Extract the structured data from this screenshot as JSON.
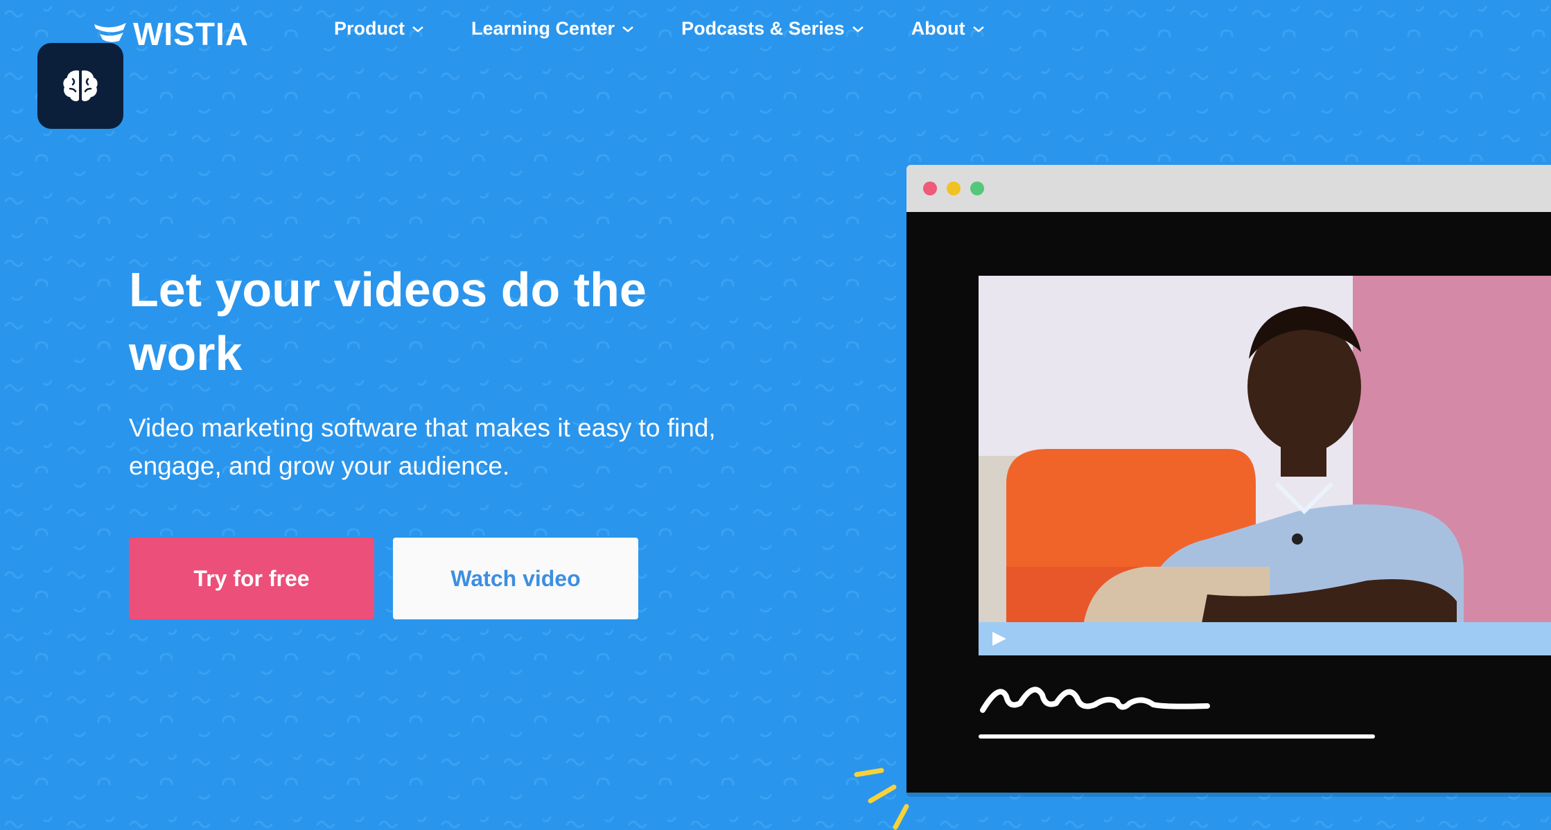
{
  "brand": {
    "name": "WISTIA"
  },
  "nav": {
    "items": [
      {
        "label": "Product"
      },
      {
        "label": "Learning Center"
      },
      {
        "label": "Podcasts & Series"
      },
      {
        "label": "About"
      }
    ]
  },
  "app_icon": {
    "icon": "brain-icon"
  },
  "hero": {
    "headline": "Let your videos do the work",
    "subhead": "Video marketing software that makes it easy to find, engage, and grow your audience.",
    "primary_cta": "Try for free",
    "secondary_cta": "Watch video"
  },
  "colors": {
    "background": "#2a95ec",
    "primary_button": "#ec4f79",
    "secondary_button_text": "#3d8fe0",
    "app_icon_bg": "#0b1f3a"
  },
  "video_player": {
    "play_icon": "play-icon"
  }
}
